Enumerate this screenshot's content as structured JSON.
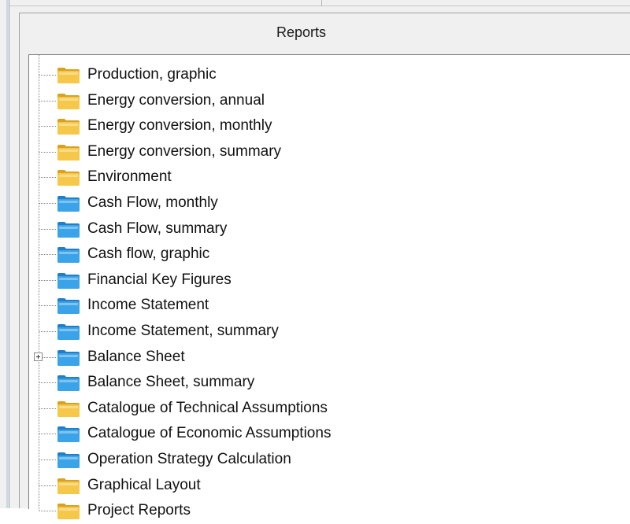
{
  "panel": {
    "title": "Reports"
  },
  "colors": {
    "yellow_folder": "#f6c84a",
    "yellow_folder_dark": "#d9a21e",
    "blue_folder": "#3ba3e8",
    "blue_folder_dark": "#1f7fc9"
  },
  "tree": {
    "items": [
      {
        "label": "Production, graphic",
        "icon": "yellow-folder-icon",
        "expandable": false
      },
      {
        "label": "Energy conversion, annual",
        "icon": "yellow-folder-icon",
        "expandable": false
      },
      {
        "label": "Energy conversion, monthly",
        "icon": "yellow-folder-icon",
        "expandable": false
      },
      {
        "label": "Energy conversion, summary",
        "icon": "yellow-folder-icon",
        "expandable": false
      },
      {
        "label": "Environment",
        "icon": "yellow-folder-icon",
        "expandable": false
      },
      {
        "label": "Cash Flow, monthly",
        "icon": "blue-folder-icon",
        "expandable": false
      },
      {
        "label": "Cash Flow, summary",
        "icon": "blue-folder-icon",
        "expandable": false
      },
      {
        "label": "Cash flow, graphic",
        "icon": "blue-folder-icon",
        "expandable": false
      },
      {
        "label": "Financial Key Figures",
        "icon": "blue-folder-icon",
        "expandable": false
      },
      {
        "label": "Income Statement",
        "icon": "blue-folder-icon",
        "expandable": false
      },
      {
        "label": "Income Statement, summary",
        "icon": "blue-folder-icon",
        "expandable": false
      },
      {
        "label": "Balance Sheet",
        "icon": "blue-folder-icon",
        "expandable": true
      },
      {
        "label": "Balance Sheet, summary",
        "icon": "blue-folder-icon",
        "expandable": false
      },
      {
        "label": "Catalogue of Technical Assumptions",
        "icon": "yellow-folder-icon",
        "expandable": false
      },
      {
        "label": "Catalogue of Economic Assumptions",
        "icon": "blue-folder-icon",
        "expandable": false
      },
      {
        "label": "Operation Strategy Calculation",
        "icon": "blue-folder-icon",
        "expandable": false
      },
      {
        "label": "Graphical Layout",
        "icon": "yellow-folder-icon",
        "expandable": false
      },
      {
        "label": "Project Reports",
        "icon": "yellow-folder-icon",
        "expandable": false
      }
    ]
  }
}
